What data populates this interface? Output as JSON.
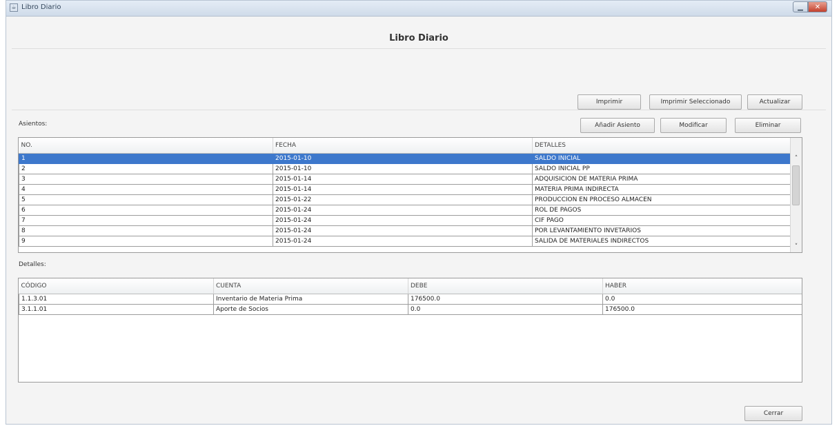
{
  "window": {
    "title": "Libro Diario",
    "minimize_icon": "minimize-icon",
    "close_icon": "close-icon"
  },
  "heading": "Libro Diario",
  "toolbar": {
    "print_label": "Imprimir",
    "print_selected_label": "Imprimir Seleccionado",
    "refresh_label": "Actualizar"
  },
  "asientos": {
    "label": "Asientos:",
    "add_label": "Añadir Asiento",
    "modify_label": "Modificar",
    "delete_label": "Eliminar",
    "columns": [
      "NO.",
      "FECHA",
      "DETALLES"
    ],
    "rows": [
      [
        "1",
        "2015-01-10",
        "SALDO INICIAL"
      ],
      [
        "2",
        "2015-01-10",
        "SALDO INICIAL PP"
      ],
      [
        "3",
        "2015-01-14",
        "ADQUISICION DE MATERIA PRIMA"
      ],
      [
        "4",
        "2015-01-14",
        "MATERIA PRIMA INDIRECTA"
      ],
      [
        "5",
        "2015-01-22",
        "PRODUCCION EN PROCESO ALMACEN"
      ],
      [
        "6",
        "2015-01-24",
        "ROL DE PAGOS"
      ],
      [
        "7",
        "2015-01-24",
        "CIF PAGO"
      ],
      [
        "8",
        "2015-01-24",
        "POR LEVANTAMIENTO INVETARIOS"
      ],
      [
        "9",
        "2015-01-24",
        "SALIDA DE MATERIALES INDIRECTOS"
      ]
    ],
    "selected_row": 0
  },
  "detalles": {
    "label": "Detalles:",
    "columns": [
      "CÓDIGO",
      "CUENTA",
      "DEBE",
      "HABER"
    ],
    "rows": [
      [
        "1.1.3.01",
        "Inventario de Materia Prima",
        "176500.0",
        "0.0"
      ],
      [
        "3.1.1.01",
        "Aporte de Socios",
        "0.0",
        "176500.0"
      ]
    ]
  },
  "close_label": "Cerrar",
  "colors": {
    "selection": "#3d78cc",
    "title_bar": "#d9e3ef"
  }
}
